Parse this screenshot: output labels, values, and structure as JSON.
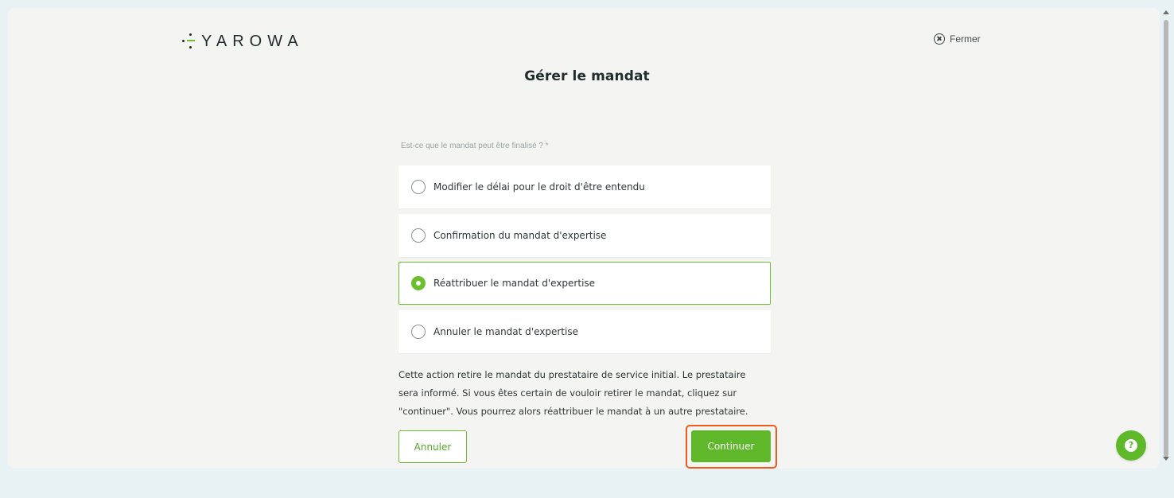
{
  "header": {
    "logo_text": "YAROWA",
    "close_label": "Fermer"
  },
  "page": {
    "title": "Gérer le mandat"
  },
  "form": {
    "question_label": "Est-ce que le mandat peut être finalisé ? *",
    "options": [
      {
        "label": "Modifier le délai pour le droit d'être entendu",
        "selected": false
      },
      {
        "label": "Confirmation du mandat d'expertise",
        "selected": false
      },
      {
        "label": "Réattribuer le mandat d'expertise",
        "selected": true
      },
      {
        "label": "Annuler le mandat d'expertise",
        "selected": false
      }
    ],
    "description_lines": [
      "Cette action retire le mandat du prestataire de service initial. Le prestataire",
      "sera informé. Si vous êtes certain de vouloir retirer le mandat, cliquez sur",
      "\"continuer\". Vous pourrez alors réattribuer le mandat à un autre prestataire."
    ]
  },
  "actions": {
    "cancel_label": "Annuler",
    "continue_label": "Continuer"
  },
  "help": {
    "icon_text": "?"
  },
  "colors": {
    "accent": "#5fb82a",
    "accent_border": "#6bbf2f",
    "highlight": "#ef5a1f",
    "page_background": "#e8f1f4",
    "panel_background": "#f4f4f2"
  },
  "icons": {
    "close": "close-icon",
    "help": "help-icon",
    "radio": "radio-icon",
    "logo": "yarowa-logo-icon"
  }
}
